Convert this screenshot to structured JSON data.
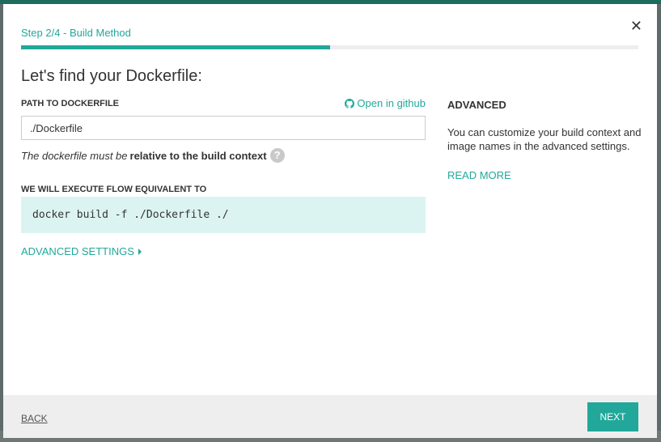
{
  "header": {
    "step_label": "Step 2/4 - Build Method",
    "progress_fraction": 0.5
  },
  "main": {
    "title": "Let's find your Dockerfile:",
    "path_field": {
      "label": "PATH TO DOCKERFILE",
      "value": "./Dockerfile",
      "github_link": "Open in github"
    },
    "hint": {
      "italic": "The dockerfile must be",
      "bold": "relative to the build context",
      "help_glyph": "?"
    },
    "exec": {
      "label": "WE WILL EXECUTE FLOW EQUIVALENT TO",
      "command": "docker build -f ./Dockerfile ./"
    },
    "advanced_settings_label": "ADVANCED SETTINGS"
  },
  "side": {
    "heading": "ADVANCED",
    "description": "You can customize your build context and image names in the advanced settings.",
    "read_more": "READ MORE"
  },
  "footer": {
    "back_label": "BACK",
    "next_label": "NEXT"
  },
  "icons": {
    "close": "close-icon",
    "github": "github-icon",
    "help": "help-icon",
    "caret": "caret-right-icon"
  },
  "colors": {
    "accent": "#21a89a",
    "code_bg": "#dcf4f1",
    "footer_bg": "#eeeeee"
  }
}
